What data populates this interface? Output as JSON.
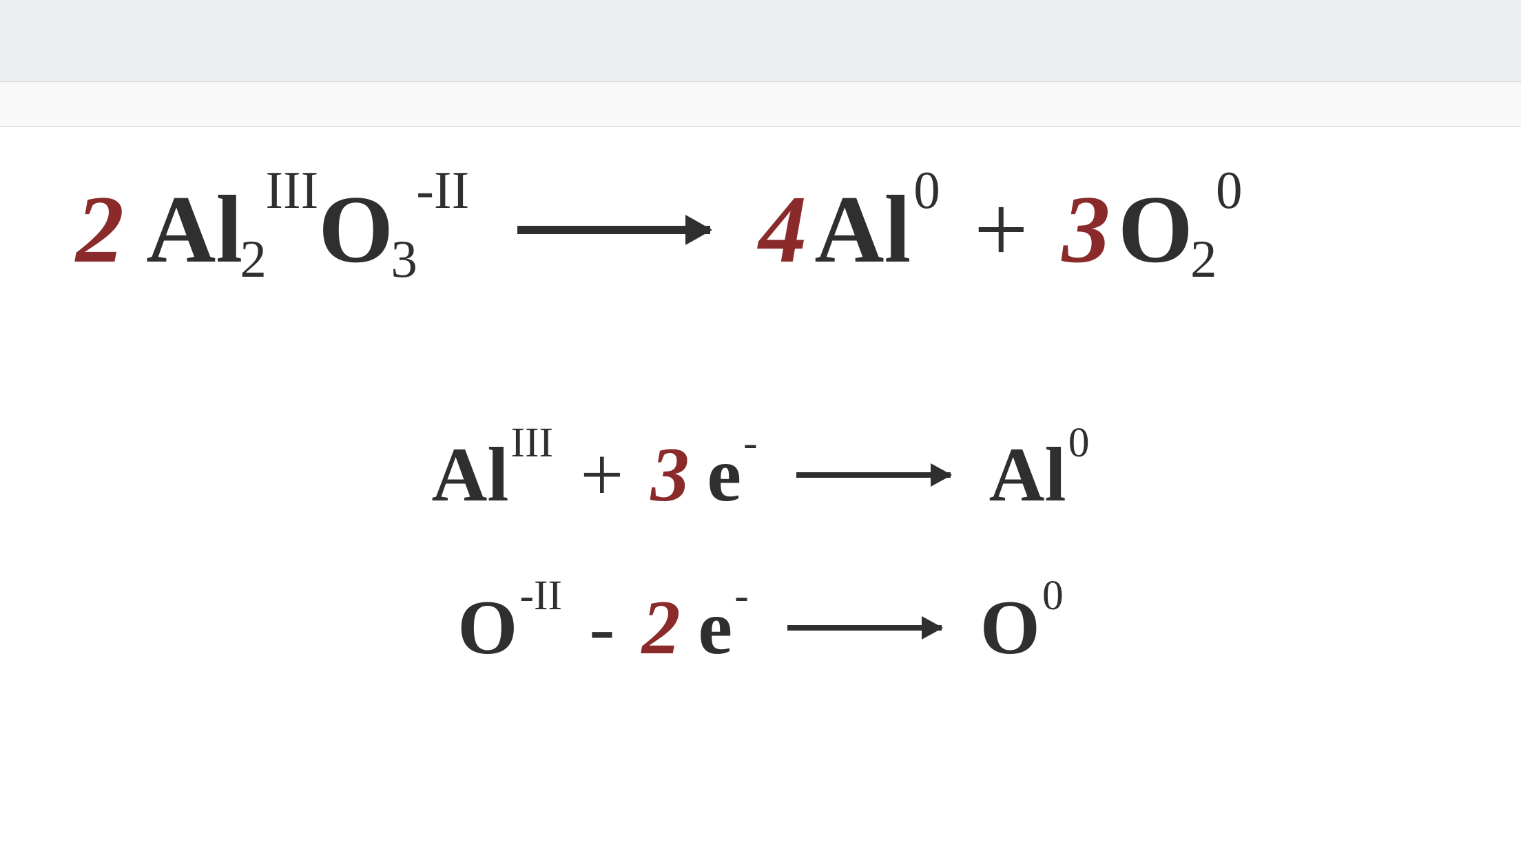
{
  "colors": {
    "coefficient": "#8b2a2a",
    "element": "#2f2f2f",
    "top_bar": "#eceeef",
    "sub_bar": "#f8f8f8"
  },
  "equation1": {
    "left": {
      "coef": "2",
      "species": [
        {
          "el": "Al",
          "sub": "2",
          "sup": "III"
        },
        {
          "el": "O",
          "sub": "3",
          "sup": "-II"
        }
      ]
    },
    "right": [
      {
        "coef": "4",
        "el": "Al",
        "sup": "0"
      },
      {
        "op": "+"
      },
      {
        "coef": "3",
        "el": "O",
        "sub": "2",
        "sup": "0"
      }
    ]
  },
  "equation2": {
    "left": [
      {
        "el": "Al",
        "sup": "III"
      },
      {
        "op": "+"
      },
      {
        "coef": "3",
        "el": "e",
        "sup": "-"
      }
    ],
    "right": [
      {
        "el": "Al",
        "sup": "0"
      }
    ]
  },
  "equation3": {
    "left": [
      {
        "el": "O",
        "sup": "-II"
      },
      {
        "op": "-"
      },
      {
        "coef": "2",
        "el": "e",
        "sup": "-"
      }
    ],
    "right": [
      {
        "el": "O",
        "sup": "0"
      }
    ]
  }
}
